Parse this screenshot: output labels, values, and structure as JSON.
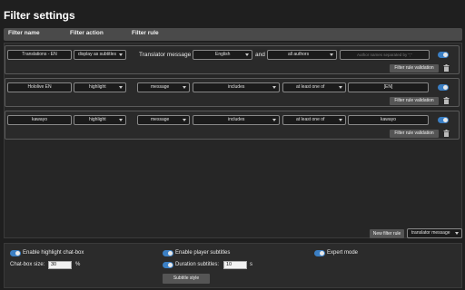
{
  "title": "Filter settings",
  "headers": {
    "name": "Filter name",
    "action": "Filter action",
    "rule": "Filter rule"
  },
  "rules": [
    {
      "name": "Translations - EN",
      "action": "display as subtitles",
      "rule_type": "Translator message",
      "language": "English",
      "conjunction": "and",
      "authors": "all authors",
      "author_placeholder": "Author names separated by \";\"",
      "validation_label": "Filter rule validation"
    },
    {
      "name": "Hololive EN",
      "action": "highlight",
      "target": "message",
      "operator": "includes",
      "quantifier": "at least one of",
      "value": "[EN]",
      "validation_label": "Filter rule validation"
    },
    {
      "name": "kawayo",
      "action": "highlight",
      "target": "message",
      "operator": "includes",
      "quantifier": "at least one of",
      "value": "kawayo",
      "validation_label": "Filter rule validation"
    }
  ],
  "new_rule_button": "New filter rule",
  "new_rule_type": "translator message",
  "settings": {
    "highlight_chatbox": "Enable highlight chat-box",
    "player_subtitles": "Enable player subtitles",
    "expert_mode": "Expert mode",
    "chatbox_size_label": "Chat-box size:",
    "chatbox_size_value": "30",
    "chatbox_size_unit": "%",
    "duration_label": "Duration subtitles:",
    "duration_value": "10",
    "duration_unit": "s",
    "subtitle_style_button": "Subtitle style"
  },
  "colors": {
    "toggle_on": "#3b7fc4",
    "background": "#1f1f1f"
  }
}
